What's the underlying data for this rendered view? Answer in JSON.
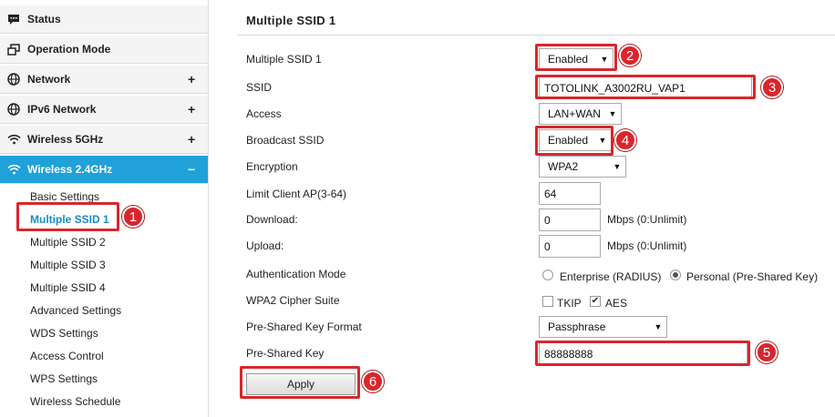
{
  "sidebar": {
    "items": [
      {
        "label": "Status",
        "icon": "message-icon",
        "expand": ""
      },
      {
        "label": "Operation Mode",
        "icon": "windows-icon",
        "expand": ""
      },
      {
        "label": "Network",
        "icon": "globe-icon",
        "expand": "+"
      },
      {
        "label": "IPv6 Network",
        "icon": "globe-icon",
        "expand": "+"
      },
      {
        "label": "Wireless 5GHz",
        "icon": "wifi-icon",
        "expand": "+"
      },
      {
        "label": "Wireless 2.4GHz",
        "icon": "wifi-icon",
        "expand": "−"
      }
    ],
    "sub_items": [
      "Basic Settings",
      "Multiple SSID 1",
      "Multiple SSID 2",
      "Multiple SSID 3",
      "Multiple SSID 4",
      "Advanced Settings",
      "WDS Settings",
      "Access Control",
      "WPS Settings",
      "Wireless Schedule"
    ],
    "active_color": "#21a1d9"
  },
  "main": {
    "title": "Multiple SSID 1",
    "labels": {
      "multiple_ssid": "Multiple SSID 1",
      "ssid": "SSID",
      "access": "Access",
      "broadcast": "Broadcast SSID",
      "encryption": "Encryption",
      "limit": "Limit Client AP(3-64)",
      "download": "Download:",
      "upload": "Upload:",
      "auth_mode": "Authentication Mode",
      "cipher": "WPA2 Cipher Suite",
      "psk_format": "Pre-Shared Key Format",
      "psk": "Pre-Shared Key"
    },
    "values": {
      "multiple_ssid": "Enabled",
      "ssid": "TOTOLINK_A3002RU_VAP1",
      "access": "LAN+WAN",
      "broadcast": "Enabled",
      "encryption": "WPA2",
      "limit": "64",
      "download": "0",
      "upload": "0",
      "psk_format": "Passphrase",
      "psk": "88888888"
    },
    "units": {
      "download": "Mbps (0:Unlimit)",
      "upload": "Mbps (0:Unlimit)"
    },
    "auth_options": [
      "Enterprise (RADIUS)",
      "Personal (Pre-Shared Key)"
    ],
    "auth_selected": "Personal (Pre-Shared Key)",
    "cipher_options": [
      {
        "label": "TKIP",
        "checked": false
      },
      {
        "label": "AES",
        "checked": true
      }
    ],
    "apply_label": "Apply"
  },
  "annotations": {
    "color": "#d9262b",
    "badges": [
      "1",
      "2",
      "3",
      "4",
      "5",
      "6"
    ]
  }
}
